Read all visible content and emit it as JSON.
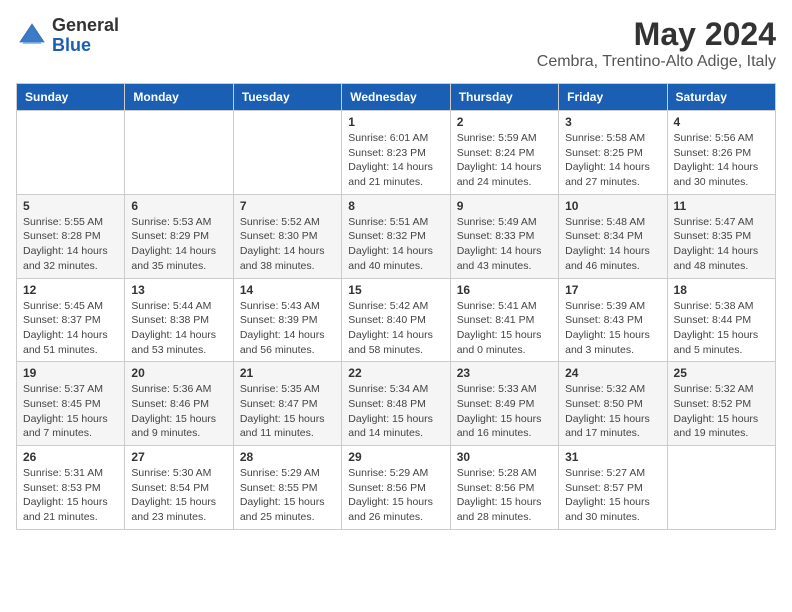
{
  "header": {
    "logo_general": "General",
    "logo_blue": "Blue",
    "month_year": "May 2024",
    "location": "Cembra, Trentino-Alto Adige, Italy"
  },
  "weekdays": [
    "Sunday",
    "Monday",
    "Tuesday",
    "Wednesday",
    "Thursday",
    "Friday",
    "Saturday"
  ],
  "weeks": [
    [
      {
        "day": "",
        "info": ""
      },
      {
        "day": "",
        "info": ""
      },
      {
        "day": "",
        "info": ""
      },
      {
        "day": "1",
        "info": "Sunrise: 6:01 AM\nSunset: 8:23 PM\nDaylight: 14 hours\nand 21 minutes."
      },
      {
        "day": "2",
        "info": "Sunrise: 5:59 AM\nSunset: 8:24 PM\nDaylight: 14 hours\nand 24 minutes."
      },
      {
        "day": "3",
        "info": "Sunrise: 5:58 AM\nSunset: 8:25 PM\nDaylight: 14 hours\nand 27 minutes."
      },
      {
        "day": "4",
        "info": "Sunrise: 5:56 AM\nSunset: 8:26 PM\nDaylight: 14 hours\nand 30 minutes."
      }
    ],
    [
      {
        "day": "5",
        "info": "Sunrise: 5:55 AM\nSunset: 8:28 PM\nDaylight: 14 hours\nand 32 minutes."
      },
      {
        "day": "6",
        "info": "Sunrise: 5:53 AM\nSunset: 8:29 PM\nDaylight: 14 hours\nand 35 minutes."
      },
      {
        "day": "7",
        "info": "Sunrise: 5:52 AM\nSunset: 8:30 PM\nDaylight: 14 hours\nand 38 minutes."
      },
      {
        "day": "8",
        "info": "Sunrise: 5:51 AM\nSunset: 8:32 PM\nDaylight: 14 hours\nand 40 minutes."
      },
      {
        "day": "9",
        "info": "Sunrise: 5:49 AM\nSunset: 8:33 PM\nDaylight: 14 hours\nand 43 minutes."
      },
      {
        "day": "10",
        "info": "Sunrise: 5:48 AM\nSunset: 8:34 PM\nDaylight: 14 hours\nand 46 minutes."
      },
      {
        "day": "11",
        "info": "Sunrise: 5:47 AM\nSunset: 8:35 PM\nDaylight: 14 hours\nand 48 minutes."
      }
    ],
    [
      {
        "day": "12",
        "info": "Sunrise: 5:45 AM\nSunset: 8:37 PM\nDaylight: 14 hours\nand 51 minutes."
      },
      {
        "day": "13",
        "info": "Sunrise: 5:44 AM\nSunset: 8:38 PM\nDaylight: 14 hours\nand 53 minutes."
      },
      {
        "day": "14",
        "info": "Sunrise: 5:43 AM\nSunset: 8:39 PM\nDaylight: 14 hours\nand 56 minutes."
      },
      {
        "day": "15",
        "info": "Sunrise: 5:42 AM\nSunset: 8:40 PM\nDaylight: 14 hours\nand 58 minutes."
      },
      {
        "day": "16",
        "info": "Sunrise: 5:41 AM\nSunset: 8:41 PM\nDaylight: 15 hours\nand 0 minutes."
      },
      {
        "day": "17",
        "info": "Sunrise: 5:39 AM\nSunset: 8:43 PM\nDaylight: 15 hours\nand 3 minutes."
      },
      {
        "day": "18",
        "info": "Sunrise: 5:38 AM\nSunset: 8:44 PM\nDaylight: 15 hours\nand 5 minutes."
      }
    ],
    [
      {
        "day": "19",
        "info": "Sunrise: 5:37 AM\nSunset: 8:45 PM\nDaylight: 15 hours\nand 7 minutes."
      },
      {
        "day": "20",
        "info": "Sunrise: 5:36 AM\nSunset: 8:46 PM\nDaylight: 15 hours\nand 9 minutes."
      },
      {
        "day": "21",
        "info": "Sunrise: 5:35 AM\nSunset: 8:47 PM\nDaylight: 15 hours\nand 11 minutes."
      },
      {
        "day": "22",
        "info": "Sunrise: 5:34 AM\nSunset: 8:48 PM\nDaylight: 15 hours\nand 14 minutes."
      },
      {
        "day": "23",
        "info": "Sunrise: 5:33 AM\nSunset: 8:49 PM\nDaylight: 15 hours\nand 16 minutes."
      },
      {
        "day": "24",
        "info": "Sunrise: 5:32 AM\nSunset: 8:50 PM\nDaylight: 15 hours\nand 17 minutes."
      },
      {
        "day": "25",
        "info": "Sunrise: 5:32 AM\nSunset: 8:52 PM\nDaylight: 15 hours\nand 19 minutes."
      }
    ],
    [
      {
        "day": "26",
        "info": "Sunrise: 5:31 AM\nSunset: 8:53 PM\nDaylight: 15 hours\nand 21 minutes."
      },
      {
        "day": "27",
        "info": "Sunrise: 5:30 AM\nSunset: 8:54 PM\nDaylight: 15 hours\nand 23 minutes."
      },
      {
        "day": "28",
        "info": "Sunrise: 5:29 AM\nSunset: 8:55 PM\nDaylight: 15 hours\nand 25 minutes."
      },
      {
        "day": "29",
        "info": "Sunrise: 5:29 AM\nSunset: 8:56 PM\nDaylight: 15 hours\nand 26 minutes."
      },
      {
        "day": "30",
        "info": "Sunrise: 5:28 AM\nSunset: 8:56 PM\nDaylight: 15 hours\nand 28 minutes."
      },
      {
        "day": "31",
        "info": "Sunrise: 5:27 AM\nSunset: 8:57 PM\nDaylight: 15 hours\nand 30 minutes."
      },
      {
        "day": "",
        "info": ""
      }
    ]
  ]
}
